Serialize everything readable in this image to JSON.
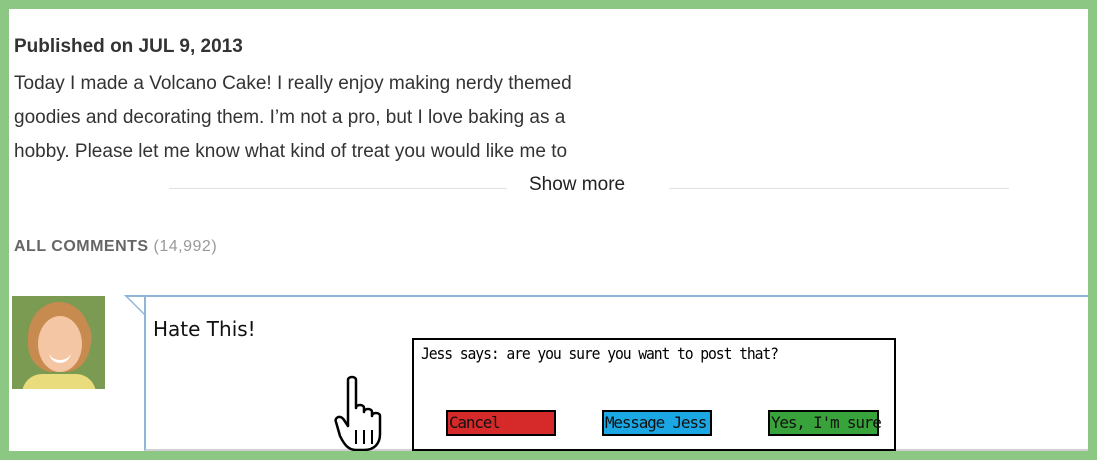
{
  "video_info": {
    "published": "Published on JUL 9, 2013",
    "description_lines": [
      "Today I made a Volcano Cake! I really enjoy making nerdy themed",
      "goodies and decorating them. I’m not a pro, but I love baking as a",
      "hobby. Please let me know what kind of treat you would like me to"
    ],
    "show_more_label": "Show more"
  },
  "comments": {
    "heading": "ALL COMMENTS",
    "count": "(14,992)"
  },
  "comment_box": {
    "text": "Hate This!"
  },
  "dialog": {
    "message": "Jess says: are you sure you want to post that?",
    "buttons": {
      "cancel": "Cancel",
      "message": "Message Jess",
      "confirm": "Yes, I'm sure"
    }
  },
  "colors": {
    "frame": "#8cc784",
    "cancel_button": "#d62a2a",
    "message_button": "#1aa7e3",
    "confirm_button": "#39a33b",
    "comment_border": "#8fb6d8"
  },
  "icons": {
    "cursor": "hand-pointer-icon"
  }
}
